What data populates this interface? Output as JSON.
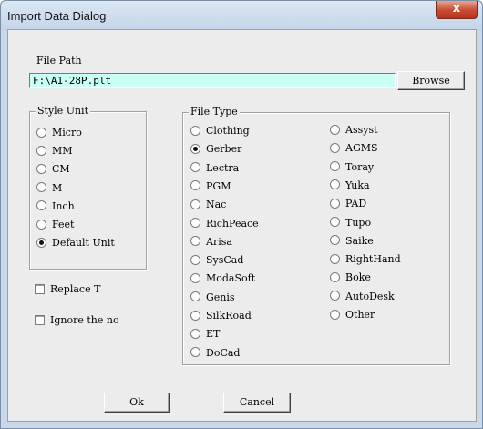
{
  "window": {
    "title": "Import Data Dialog",
    "close_glyph": "x"
  },
  "file_path": {
    "label": "File Path",
    "value": "F:\\A1-28P.plt",
    "browse_label": "Browse"
  },
  "style_unit": {
    "legend": "Style Unit",
    "options": [
      "Micro",
      "MM",
      "CM",
      "M",
      "Inch",
      "Feet",
      "Default Unit"
    ],
    "selected": "Default Unit"
  },
  "checks": {
    "replace_label": "Replace T",
    "ignore_label": "Ignore the no"
  },
  "file_type": {
    "legend": "File Type",
    "left": [
      "Clothing",
      "Gerber",
      "Lectra",
      "PGM",
      "Nac",
      "RichPeace",
      "Arisa",
      "SysCad",
      "ModaSoft",
      "Genis",
      "SilkRoad",
      "ET",
      "DoCad"
    ],
    "right": [
      "Assyst",
      "AGMS",
      "Toray",
      "Yuka",
      "PAD",
      "Tupo",
      "Saike",
      "RightHand",
      "Boke",
      "AutoDesk",
      "Other"
    ],
    "selected": "Gerber"
  },
  "buttons": {
    "ok": "Ok",
    "cancel": "Cancel"
  }
}
